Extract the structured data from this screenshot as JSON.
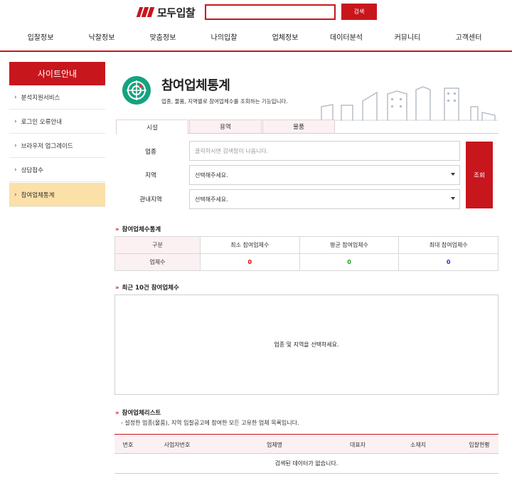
{
  "header": {
    "brand": "모두입찰",
    "search_button": "검색",
    "search_value": ""
  },
  "nav": [
    "입찰정보",
    "낙찰정보",
    "맞춤정보",
    "나의입찰",
    "업체정보",
    "데이터분석",
    "커뮤니티",
    "고객센터"
  ],
  "sidebar": {
    "title": "사이트안내",
    "items": [
      {
        "label": "분석지원서비스",
        "active": false
      },
      {
        "label": "로그인 오류안내",
        "active": false
      },
      {
        "label": "브라우저 업그레이드",
        "active": false
      },
      {
        "label": "상담접수",
        "active": false
      },
      {
        "label": "참여업체통계",
        "active": true
      }
    ]
  },
  "page": {
    "title": "참여업체통계",
    "description": "업종, 물품, 지역별로 참여업체수를 조회하는 기능입니다."
  },
  "tabs": [
    {
      "label": "시설",
      "active": true
    },
    {
      "label": "용역",
      "active": false
    },
    {
      "label": "물품",
      "active": false
    }
  ],
  "form": {
    "industry_label": "업종",
    "industry_placeholder": "클릭하시면 검색창이 나옵니다.",
    "region_label": "지역",
    "region_value": "선택해주세요.",
    "jurisdiction_label": "관내지역",
    "jurisdiction_value": "선택해주세요.",
    "submit": "조회"
  },
  "stats": {
    "heading": "참여업체수통계",
    "headers": [
      "구분",
      "최소 참여업체수",
      "평균 참여업체수",
      "최대 참여업체수"
    ],
    "row_label": "업체수",
    "min": "0",
    "avg": "0",
    "max": "0"
  },
  "recent": {
    "heading": "최근 10건 참여업체수",
    "message": "업종 및 지역을 선택하세요."
  },
  "list": {
    "heading": "참여업체리스트",
    "description": "- 설정한 업종(물품), 지역 입찰공고에 참여한 모든 고유한 업체 목록입니다.",
    "columns": [
      "번호",
      "사업자번호",
      "업체명",
      "대표자",
      "소재지",
      "입찰현황"
    ],
    "empty": "검색된 데이터가 없습니다."
  },
  "colors": {
    "accent": "#c8161d",
    "active_sidebar": "#fbe0a8",
    "pink_bg": "#fbf1f2",
    "icon_green": "#14a37f"
  }
}
